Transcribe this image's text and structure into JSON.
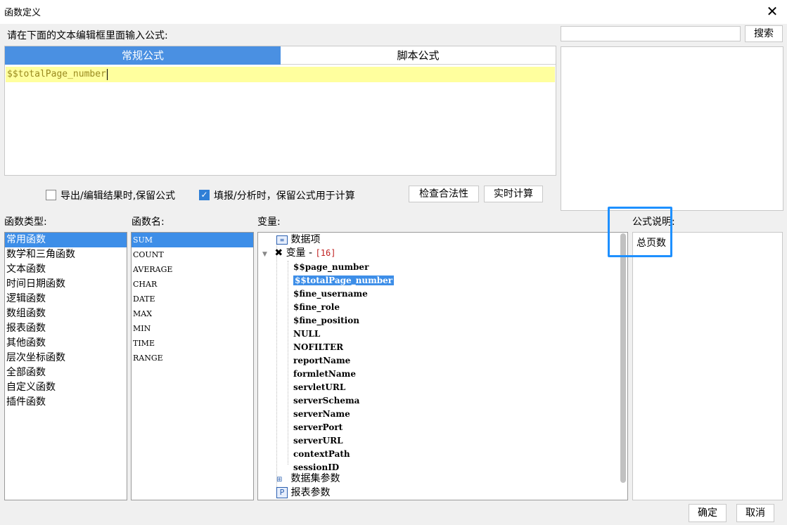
{
  "window": {
    "title": "函数定义",
    "close_symbol": "✕"
  },
  "editor": {
    "prompt": "请在下面的文本编辑框里面输入公式:",
    "tabs": [
      {
        "label": "常规公式",
        "active": true
      },
      {
        "label": "脚本公式",
        "active": false
      }
    ],
    "formula": "$$totalPage_number"
  },
  "options": {
    "keep_formula_on_export": {
      "label": "导出/编辑结果时,保留公式",
      "checked": false
    },
    "keep_formula_on_fill": {
      "label": "填报/分析时，保留公式用于计算",
      "checked": true
    },
    "check_button": "检查合法性",
    "realtime_button": "实时计算"
  },
  "search": {
    "value": "",
    "button": "搜索"
  },
  "function_types": {
    "label": "函数类型:",
    "items": [
      "常用函数",
      "数学和三角函数",
      "文本函数",
      "时间日期函数",
      "逻辑函数",
      "数组函数",
      "报表函数",
      "其他函数",
      "层次坐标函数",
      "全部函数",
      "自定义函数",
      "插件函数"
    ],
    "selected_index": 0
  },
  "function_names": {
    "label": "函数名:",
    "items": [
      "SUM",
      "COUNT",
      "AVERAGE",
      "CHAR",
      "DATE",
      "MAX",
      "MIN",
      "TIME",
      "RANGE"
    ],
    "selected_index": 0
  },
  "variables": {
    "label": "变量:",
    "data_item": "数据项",
    "group_label": "变量 - ",
    "group_count": "[16]",
    "items": [
      "$$page_number",
      "$$totalPage_number",
      "$fine_username",
      "$fine_role",
      "$fine_position",
      "NULL",
      "NOFILTER",
      "reportName",
      "formletName",
      "servletURL",
      "serverSchema",
      "serverName",
      "serverPort",
      "serverURL",
      "contextPath",
      "sessionID"
    ],
    "selected_index": 1,
    "dataset_params": "数据集参数",
    "report_params": "报表参数"
  },
  "description": {
    "label": "公式说明:",
    "text": "总页数"
  },
  "footer": {
    "ok": "确定",
    "cancel": "取消"
  },
  "colors": {
    "accent": "#3d8ee8",
    "formula_bg": "#ffff9e",
    "highlight_border": "#1e90ff"
  }
}
